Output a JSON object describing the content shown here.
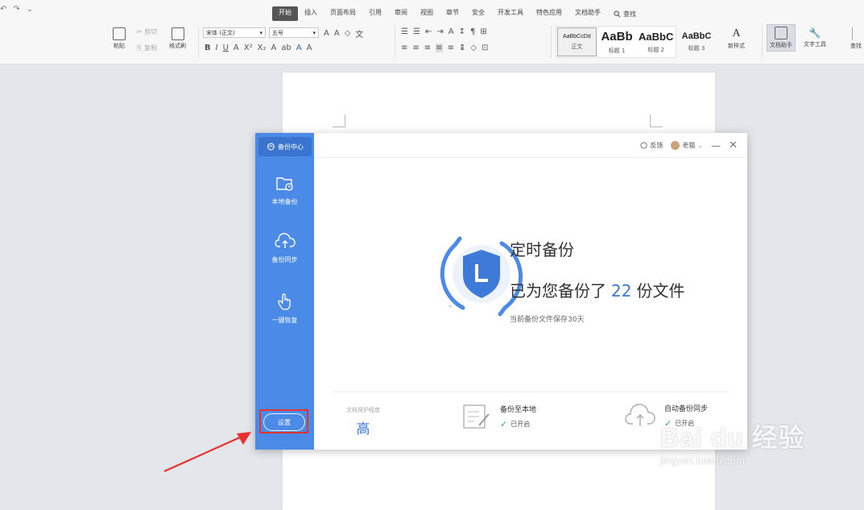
{
  "ribbon": {
    "quick_access": [
      "↶",
      "↷",
      "⌄"
    ],
    "tabs": [
      "开始",
      "插入",
      "页面布局",
      "引用",
      "审阅",
      "视图",
      "章节",
      "安全",
      "开发工具",
      "特色应用",
      "文档助手"
    ],
    "search_label": "查找",
    "clipboard": {
      "paste": "粘贴",
      "cut": "剪切",
      "copy": "复制",
      "format_painter": "格式刷"
    },
    "font_name": "宋体 (正文)",
    "font_size": "五号",
    "styles": [
      {
        "sample": "AaBbCcDd",
        "label": "正文"
      },
      {
        "sample": "AaBb",
        "label": "标题 1"
      },
      {
        "sample": "AaBbC",
        "label": "标题 2"
      },
      {
        "sample": "AaBbC",
        "label": "标题 3"
      }
    ],
    "new_style": "新样式",
    "doc_assistant": "文档助手",
    "text_tools": "文字工具",
    "find_cut": "查找"
  },
  "dialog": {
    "sidebar_title": "备份中心",
    "nav": [
      {
        "label": "本地备份",
        "icon": "folder-clock-icon"
      },
      {
        "label": "备份同步",
        "icon": "cloud-upload-icon"
      },
      {
        "label": "一键恢复",
        "icon": "hand-pointer-icon"
      }
    ],
    "settings": "设置",
    "feedback": "反馈",
    "user": "老猫",
    "heading": "定时备份",
    "status_prefix": "已为您备份了",
    "status_count": "22",
    "status_suffix": "份文件",
    "note": "当前备份文件保存30天",
    "protection_label": "文档保护程度",
    "protection_level": "高",
    "local_backup": {
      "name": "备份至本地",
      "state": "已开启"
    },
    "auto_sync": {
      "name": "自动备份同步",
      "state": "已开启"
    },
    "accent": "#4b8ae6",
    "highlight": "#e8312f"
  },
  "watermark": {
    "brand": "Bai du 经验",
    "url": "jingyan.baidu.com"
  }
}
